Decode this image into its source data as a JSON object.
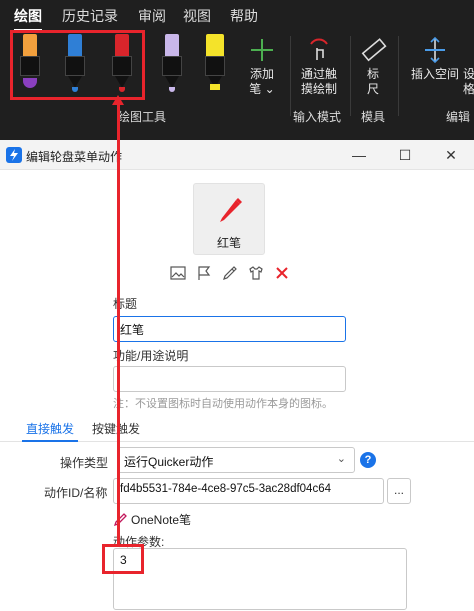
{
  "ribbon": {
    "tabs": [
      {
        "label": "绘图",
        "active": true
      },
      {
        "label": "历史记录",
        "active": false
      },
      {
        "label": "审阅",
        "active": false
      },
      {
        "label": "视图",
        "active": false
      },
      {
        "label": "帮助",
        "active": false
      }
    ],
    "pens": [
      {
        "name": "orange-pen",
        "color": "#f2a03d",
        "ink": "#8a3fbf"
      },
      {
        "name": "blue-pen",
        "color": "#2f7fd6",
        "ink": "#2f7fd6"
      },
      {
        "name": "red-pen",
        "color": "#d9252b",
        "ink": "#d9252b"
      },
      {
        "name": "lavender-pen",
        "color": "#c9b7ea",
        "ink": "#c9b7ea"
      },
      {
        "name": "yellow-highlighter",
        "color": "#f4e32a",
        "ink": "#f4e32a"
      }
    ],
    "add_pen_label": "添加",
    "add_pen_label2": "笔 ⌄",
    "touch_draw_label": "通过触",
    "touch_draw_label2": "摸绘制",
    "ruler_label": "标",
    "ruler_label2": "尺",
    "insert_space_label": "插入空间",
    "cut_label": "设",
    "cut_label2": "格",
    "groups": {
      "draw_tools": "绘图工具",
      "input_mode": "输入模式",
      "model": "模具",
      "edit": "编辑"
    },
    "accent": "#e8242c"
  },
  "dialog": {
    "title": "编辑轮盘菜单动作",
    "minimize": "—",
    "maximize": "☐",
    "close": "✕",
    "icon_name": "红笔",
    "title_label": "标题",
    "title_value": "红笔",
    "desc_label": "功能/用途说明",
    "desc_hint": "注：不设置图标时自动使用动作本身的图标。",
    "tabs": [
      {
        "label": "直接触发",
        "active": true
      },
      {
        "label": "按键触发",
        "active": false
      }
    ],
    "op_type_label": "操作类型",
    "op_type_value": "运行Quicker动作",
    "help_glyph": "?",
    "action_id_label": "动作ID/名称",
    "action_id_value": "fd4b5531-784e-4ce8-97c5-3ac28df04c64",
    "ellipsis": "...",
    "linked_action": "OneNote笔",
    "params_label": "动作参数:",
    "params_value": "3",
    "accent_blue": "#1a73e8"
  }
}
